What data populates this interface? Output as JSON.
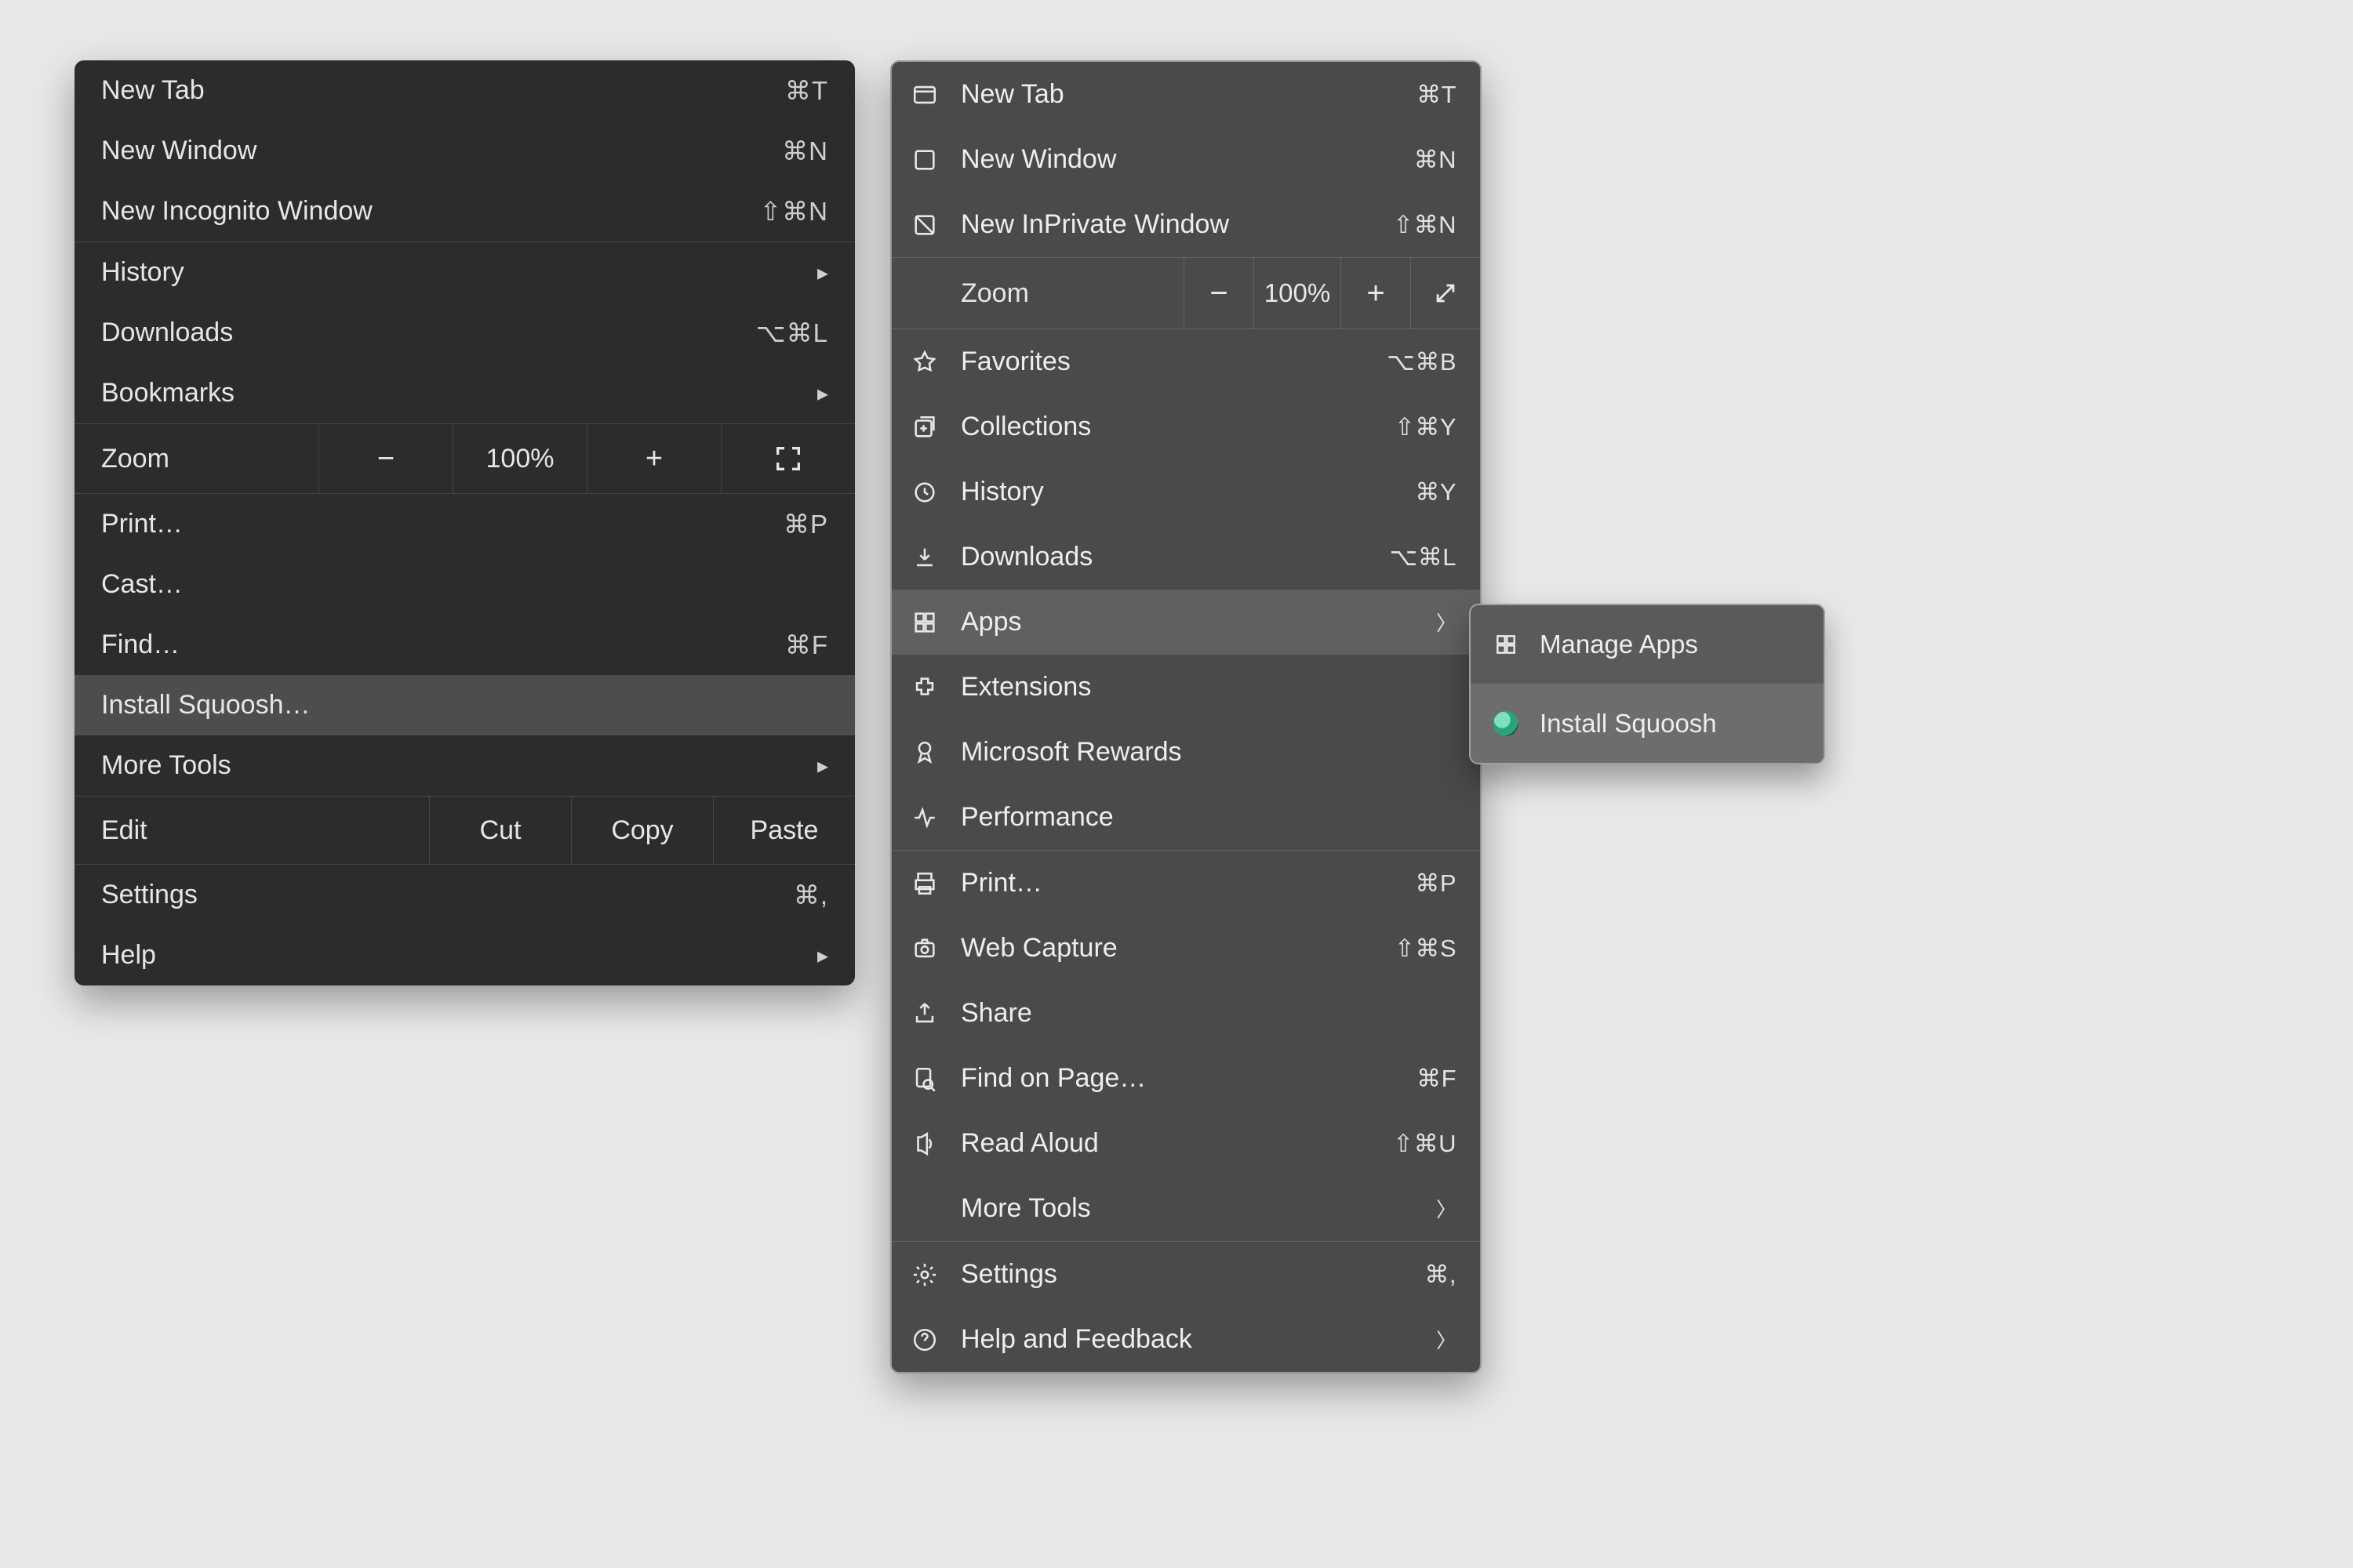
{
  "chrome": {
    "group1": [
      {
        "label": "New Tab",
        "kbd": "⌘T"
      },
      {
        "label": "New Window",
        "kbd": "⌘N"
      },
      {
        "label": "New Incognito Window",
        "kbd": "⇧⌘N"
      }
    ],
    "group2": [
      {
        "label": "History",
        "chev": true
      },
      {
        "label": "Downloads",
        "kbd": "⌥⌘L"
      },
      {
        "label": "Bookmarks",
        "chev": true
      }
    ],
    "zoom": {
      "label": "Zoom",
      "value": "100%",
      "minus": "−",
      "plus": "+"
    },
    "group3": [
      {
        "label": "Print…",
        "kbd": "⌘P"
      },
      {
        "label": "Cast…"
      },
      {
        "label": "Find…",
        "kbd": "⌘F"
      },
      {
        "label": "Install Squoosh…",
        "highlight": true
      },
      {
        "label": "More Tools",
        "chev": true
      }
    ],
    "edit": {
      "label": "Edit",
      "cut": "Cut",
      "copy": "Copy",
      "paste": "Paste"
    },
    "group4": [
      {
        "label": "Settings",
        "kbd": "⌘,"
      },
      {
        "label": "Help",
        "chev": true
      }
    ]
  },
  "edge": {
    "group1": [
      {
        "icon": "new-tab-icon",
        "label": "New Tab",
        "kbd": "⌘T"
      },
      {
        "icon": "new-window-icon",
        "label": "New Window",
        "kbd": "⌘N"
      },
      {
        "icon": "inprivate-icon",
        "label": "New InPrivate Window",
        "kbd": "⇧⌘N"
      }
    ],
    "zoom": {
      "label": "Zoom",
      "value": "100%",
      "minus": "−",
      "plus": "+"
    },
    "group2": [
      {
        "icon": "star-icon",
        "label": "Favorites",
        "kbd": "⌥⌘B"
      },
      {
        "icon": "collections-icon",
        "label": "Collections",
        "kbd": "⇧⌘Y"
      },
      {
        "icon": "history-icon",
        "label": "History",
        "kbd": "⌘Y"
      },
      {
        "icon": "download-icon",
        "label": "Downloads",
        "kbd": "⌥⌘L"
      },
      {
        "icon": "apps-icon",
        "label": "Apps",
        "chev": true,
        "highlight": true
      },
      {
        "icon": "extensions-icon",
        "label": "Extensions"
      },
      {
        "icon": "rewards-icon",
        "label": "Microsoft Rewards"
      },
      {
        "icon": "performance-icon",
        "label": "Performance"
      }
    ],
    "group3": [
      {
        "icon": "print-icon",
        "label": "Print…",
        "kbd": "⌘P"
      },
      {
        "icon": "capture-icon",
        "label": "Web Capture",
        "kbd": "⇧⌘S"
      },
      {
        "icon": "share-icon",
        "label": "Share"
      },
      {
        "icon": "find-icon",
        "label": "Find on Page…",
        "kbd": "⌘F"
      },
      {
        "icon": "read-aloud-icon",
        "label": "Read Aloud",
        "kbd": "⇧⌘U"
      },
      {
        "icon": "",
        "label": "More Tools",
        "chev": true
      }
    ],
    "group4": [
      {
        "icon": "settings-icon",
        "label": "Settings",
        "kbd": "⌘,"
      },
      {
        "icon": "help-icon",
        "label": "Help and Feedback",
        "chev": true
      }
    ]
  },
  "appsSub": {
    "items": [
      {
        "icon": "apps-icon",
        "label": "Manage Apps"
      },
      {
        "icon": "squoosh-icon",
        "label": "Install Squoosh",
        "highlight": true
      }
    ]
  }
}
